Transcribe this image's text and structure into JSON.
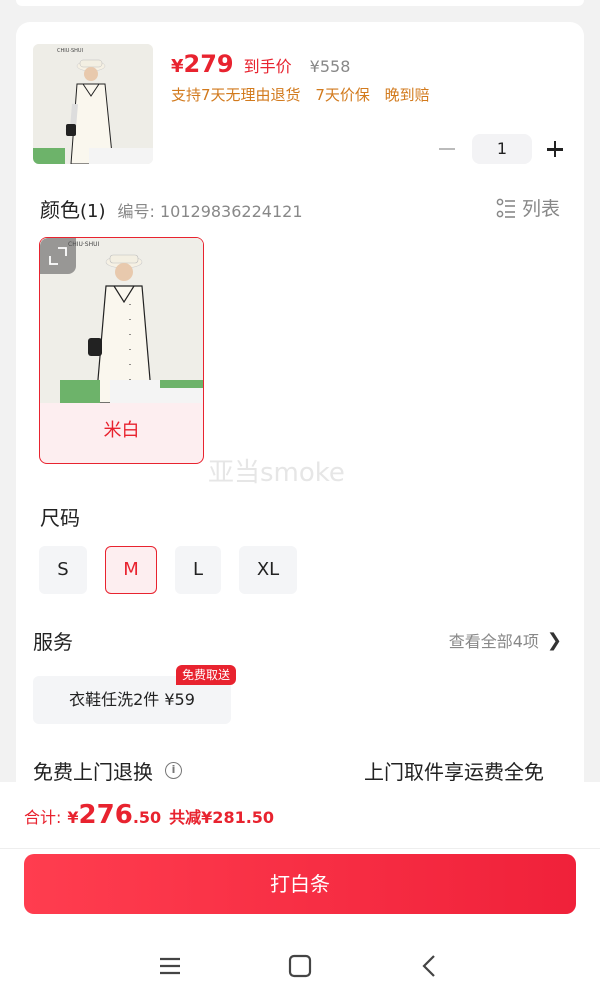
{
  "product": {
    "yen": "¥",
    "price": "279",
    "price_label": "到手价",
    "original_price": "¥558",
    "perks": [
      "支持7天无理由退货",
      "7天价保",
      "晚到赔"
    ],
    "quantity": "1"
  },
  "color": {
    "title": "颜色",
    "count": "(1)",
    "sku": "编号: 10129836224121",
    "list_label": "列表",
    "options": [
      {
        "label": "米白"
      }
    ]
  },
  "size": {
    "title": "尺码",
    "options": [
      "S",
      "M",
      "L",
      "XL"
    ],
    "selected": "M"
  },
  "service": {
    "title": "服务",
    "view_all": "查看全部4项",
    "chip_label": "衣鞋任洗2件 ¥59",
    "chip_tag": "免费取送"
  },
  "returns": {
    "title": "免费上门退换",
    "note": "上门取件享运费全免"
  },
  "footer": {
    "total_label": "合计:",
    "total_yen": "¥",
    "total_int": "276",
    "total_dec": ".50",
    "savings": "共减¥281.50",
    "pay_button": "打白条"
  },
  "watermark": "亚当smoke",
  "colors": {
    "accent": "#e8232f",
    "perk": "#d27a1d",
    "chip_bg": "#f4f5f7",
    "selected_bg": "#fdeef0"
  }
}
